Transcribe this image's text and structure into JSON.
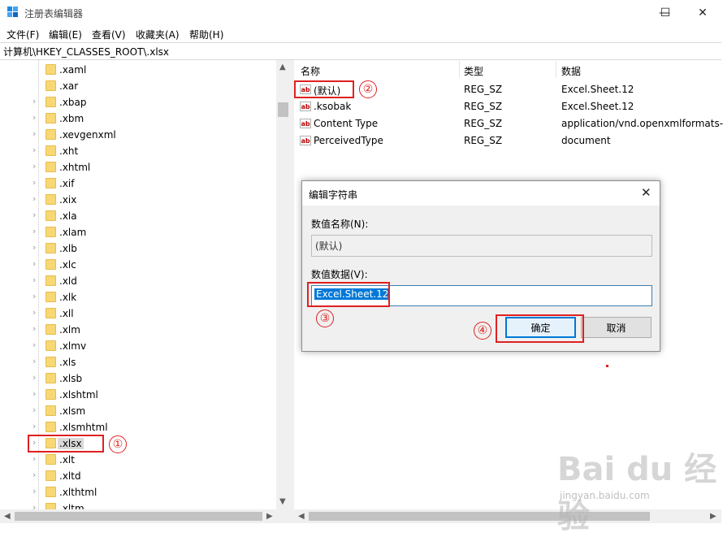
{
  "window": {
    "title": "注册表编辑器",
    "minimize": "—",
    "maximize": "☐",
    "close": "✕"
  },
  "menu": [
    "文件(F)",
    "编辑(E)",
    "查看(V)",
    "收藏夹(A)",
    "帮助(H)"
  ],
  "address": "计算机\\HKEY_CLASSES_ROOT\\.xlsx",
  "tree": {
    "items": [
      ".xaml",
      ".xar",
      ".xbap",
      ".xbm",
      ".xevgenxml",
      ".xht",
      ".xhtml",
      ".xif",
      ".xix",
      ".xla",
      ".xlam",
      ".xlb",
      ".xlc",
      ".xld",
      ".xlk",
      ".xll",
      ".xlm",
      ".xlmv",
      ".xls",
      ".xlsb",
      ".xlshtml",
      ".xlsm",
      ".xlsmhtml",
      ".xlsx",
      ".xlt",
      ".xltd",
      ".xlthtml",
      ".xltm"
    ],
    "selected": ".xlsx"
  },
  "list": {
    "headers": [
      "名称",
      "类型",
      "数据"
    ],
    "rows": [
      {
        "icon": "ab",
        "name": "(默认)",
        "type": "REG_SZ",
        "data": "Excel.Sheet.12"
      },
      {
        "icon": "ab",
        "name": ".ksobak",
        "type": "REG_SZ",
        "data": "Excel.Sheet.12"
      },
      {
        "icon": "ab",
        "name": "Content Type",
        "type": "REG_SZ",
        "data": "application/vnd.openxmlformats-"
      },
      {
        "icon": "ab",
        "name": "PerceivedType",
        "type": "REG_SZ",
        "data": "document"
      }
    ]
  },
  "dialog": {
    "title": "编辑字符串",
    "close": "✕",
    "name_label": "数值名称(N):",
    "name_value": "(默认)",
    "data_label": "数值数据(V):",
    "data_value": "Excel.Sheet.12",
    "ok_label": "确定",
    "cancel_label": "取消"
  },
  "annotations": [
    "①",
    "②",
    "③",
    "④"
  ],
  "watermark": {
    "text": "Bai du 经验",
    "sub": "jingyan.baidu.com"
  },
  "colors": {
    "annotation_red": "#e02020",
    "selection_blue": "#0078d7",
    "folder_yellow": "#f8d775"
  }
}
